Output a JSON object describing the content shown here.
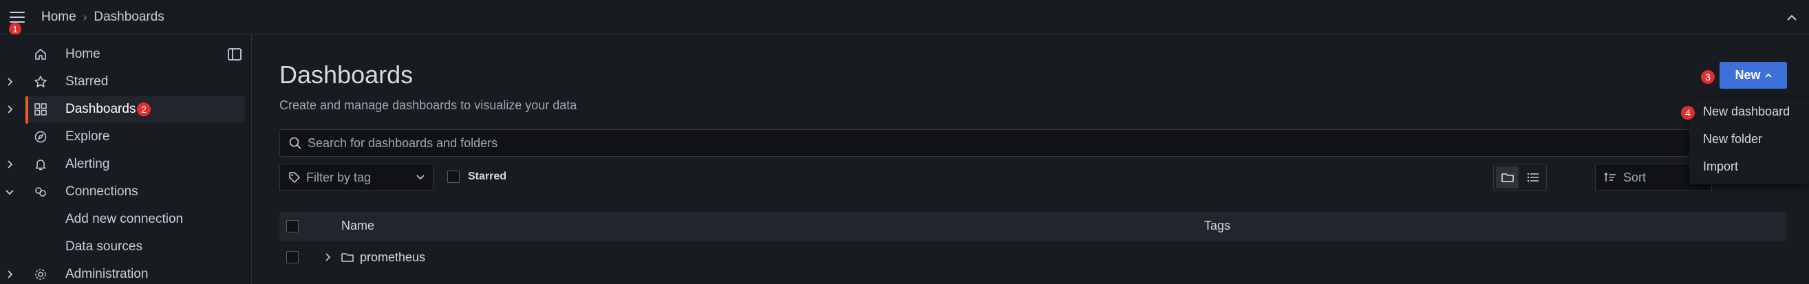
{
  "breadcrumb": {
    "home": "Home",
    "separator": "›",
    "current": "Dashboards"
  },
  "badges": {
    "menu": "1",
    "dashboards": "2",
    "new_button": "3",
    "new_dashboard": "4"
  },
  "sidebar": {
    "items": [
      {
        "label": "Home",
        "icon": "home-icon",
        "expandable": false
      },
      {
        "label": "Starred",
        "icon": "star-icon",
        "expandable": true
      },
      {
        "label": "Dashboards",
        "icon": "apps-icon",
        "expandable": true,
        "active": true
      },
      {
        "label": "Explore",
        "icon": "compass-icon",
        "expandable": false
      },
      {
        "label": "Alerting",
        "icon": "bell-icon",
        "expandable": true
      },
      {
        "label": "Connections",
        "icon": "plug-icon",
        "expandable": true,
        "expanded": true
      },
      {
        "label": "Add new connection",
        "icon": "",
        "child": true
      },
      {
        "label": "Data sources",
        "icon": "",
        "child": true
      },
      {
        "label": "Administration",
        "icon": "cog-icon",
        "expandable": true
      }
    ]
  },
  "main": {
    "title": "Dashboards",
    "subtitle": "Create and manage dashboards to visualize your data",
    "search_placeholder": "Search for dashboards and folders",
    "tag_filter_placeholder": "Filter by tag",
    "starred_label": "Starred",
    "sort_placeholder": "Sort",
    "view_mode": "folders"
  },
  "table": {
    "headers": {
      "name": "Name",
      "tags": "Tags"
    },
    "rows": [
      {
        "name": "prometheus",
        "type": "folder"
      }
    ]
  },
  "new_button": {
    "label": "New",
    "caret": "⌃"
  },
  "new_menu": {
    "items": [
      "New dashboard",
      "New folder",
      "Import"
    ]
  },
  "colors": {
    "accent": "#f05a28",
    "primary": "#3d71d9",
    "badge": "#e02f2f",
    "background": "#181b1f"
  }
}
